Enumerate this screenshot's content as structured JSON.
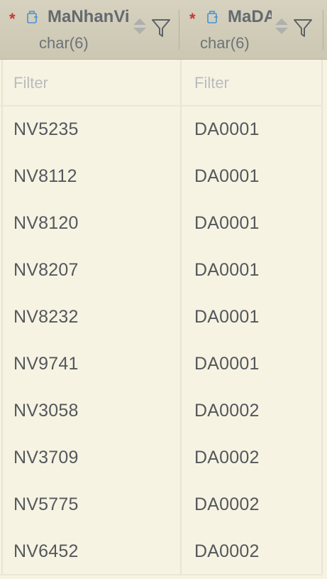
{
  "columns": [
    {
      "required_mark": "*",
      "name": "MaNhanVien",
      "type": "char(6)",
      "filter_placeholder": "Filter"
    },
    {
      "required_mark": "*",
      "name": "MaDA",
      "type": "char(6)",
      "filter_placeholder": "Filter"
    }
  ],
  "rows": [
    [
      "NV5235",
      "DA0001"
    ],
    [
      "NV8112",
      "DA0001"
    ],
    [
      "NV8120",
      "DA0001"
    ],
    [
      "NV8207",
      "DA0001"
    ],
    [
      "NV8232",
      "DA0001"
    ],
    [
      "NV9741",
      "DA0001"
    ],
    [
      "NV3058",
      "DA0002"
    ],
    [
      "NV3709",
      "DA0002"
    ],
    [
      "NV5775",
      "DA0002"
    ],
    [
      "NV6452",
      "DA0002"
    ]
  ],
  "colors": {
    "background": "#f7f3e3",
    "header": "#cfcbb6",
    "required": "#c93535",
    "key_icon": "#4a8fd6"
  },
  "icons": [
    "primary-key-icon",
    "sort-icon",
    "filter-icon"
  ]
}
